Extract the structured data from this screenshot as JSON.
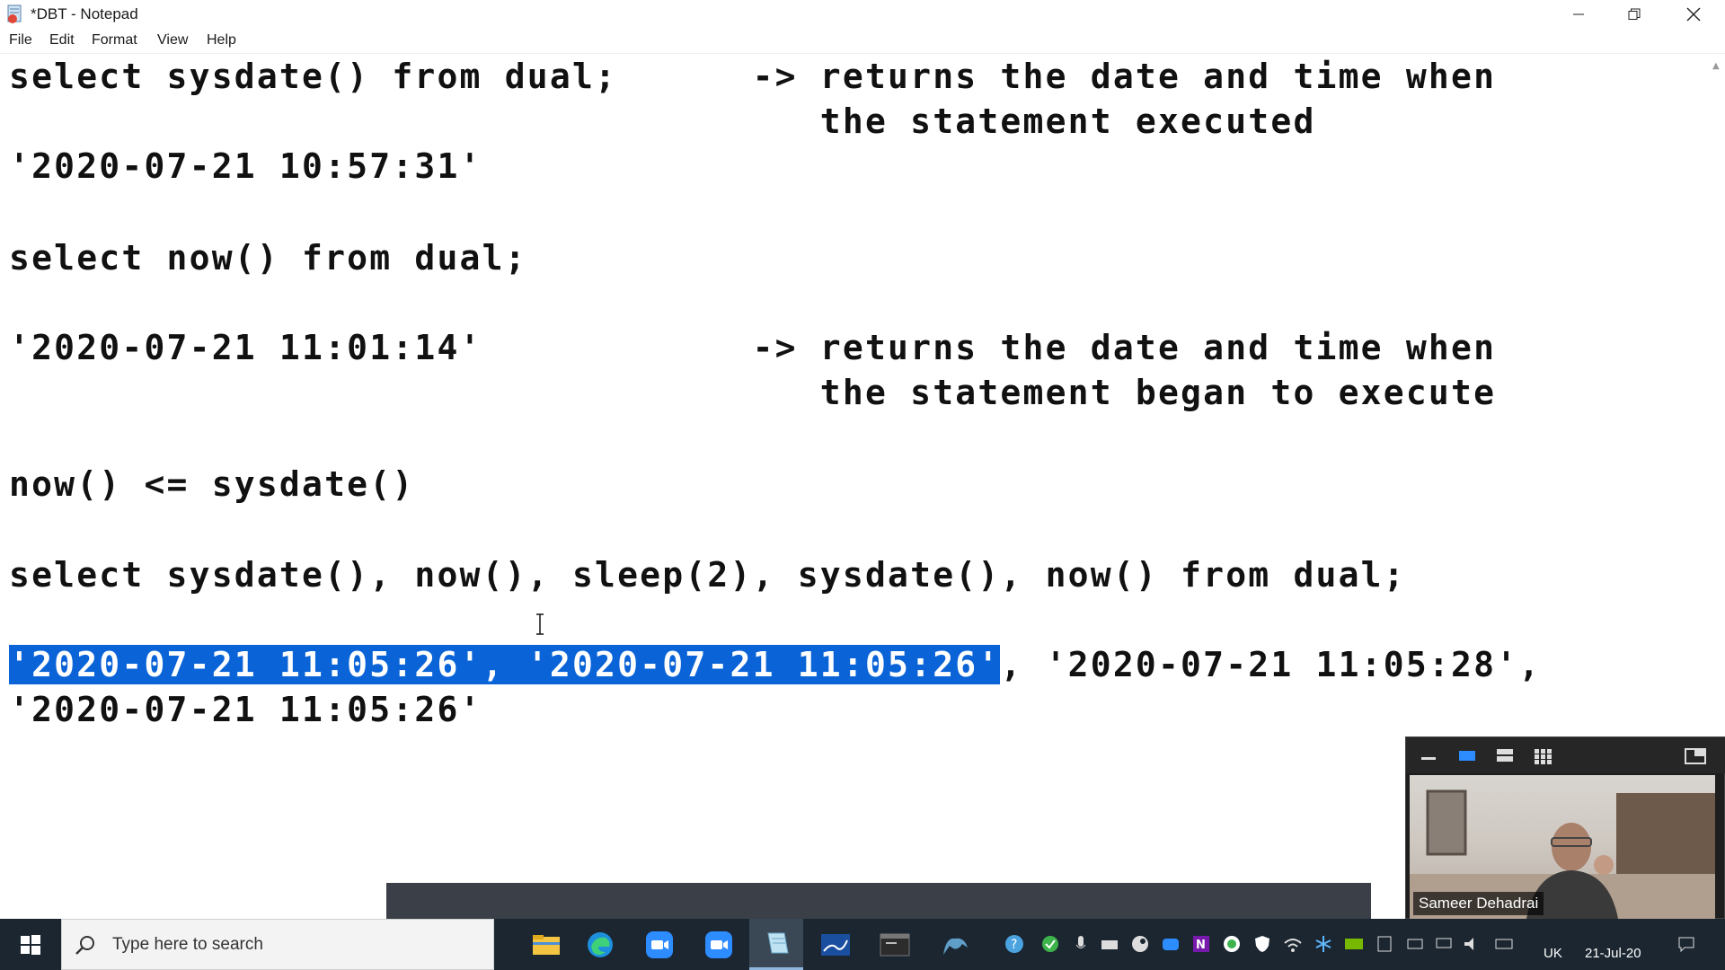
{
  "window": {
    "title": "*DBT - Notepad",
    "controls": {
      "minimize": "minimize",
      "restore": "restore",
      "close": "close"
    }
  },
  "menu": {
    "file": "File",
    "edit": "Edit",
    "format": "Format",
    "view": "View",
    "help": "Help"
  },
  "editor": {
    "lines": [
      "select sysdate() from dual;      -> returns the date and time when",
      "                                    the statement executed",
      "'2020-07-21 10:57:31'",
      "select now() from dual;",
      "'2020-07-21 11:01:14'            -> returns the date and time when",
      "                                    the statement began to execute",
      "now() <= sysdate()",
      "select sysdate(), now(), sleep(2), sysdate(), now() from dual;",
      "'2020-07-21 11:05:26', '2020-07-21 11:05:26'",
      ", '2020-07-21 11:05:28',",
      "'2020-07-21 11:05:26'"
    ],
    "selected_text": "'2020-07-21 11:05:26', '2020-07-21 11:05:26'"
  },
  "video": {
    "participant_name": "Sameer Dehadrai",
    "toolbar_icons": [
      "minimize-icon",
      "active-speaker-icon",
      "strip-view-icon",
      "gallery-view-icon",
      "exit-fullscreen-icon"
    ]
  },
  "taskbar": {
    "search_placeholder": "Type here to search",
    "apps": [
      "file-explorer-icon",
      "edge-icon",
      "zoom-icon",
      "zoom-meetings-icon",
      "notepad-icon",
      "whiteboard-icon",
      "sql-terminal-icon",
      "mysql-workbench-icon"
    ],
    "tray": {
      "language": "UK",
      "date": "21-Jul-20"
    }
  },
  "colors": {
    "selection": "#0a64d8",
    "taskbar": "#1b2631",
    "share_bar": "#3a3f48"
  }
}
